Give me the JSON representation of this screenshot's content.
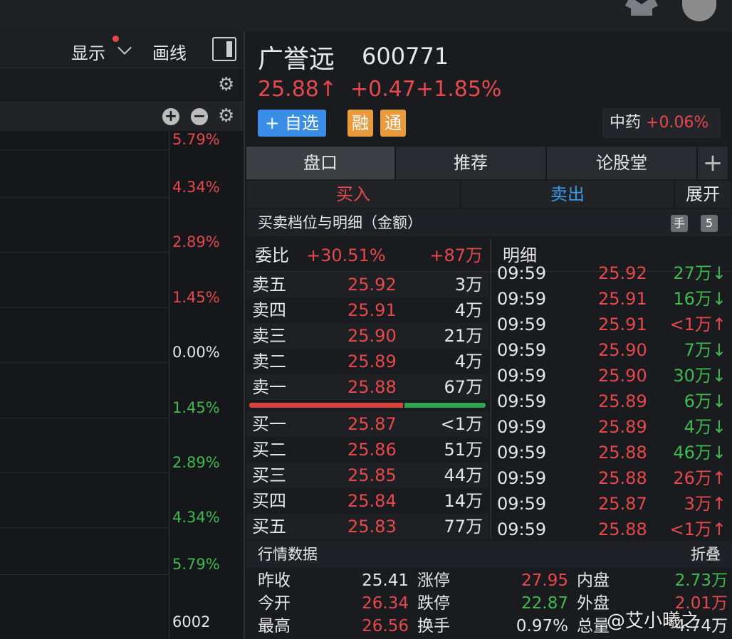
{
  "left_toolbar": {
    "display_label": "显示",
    "draw_label": "画线"
  },
  "axis_labels": [
    {
      "text": "5.79%",
      "color": "#e5484d"
    },
    {
      "text": "4.34%",
      "color": "#e5484d"
    },
    {
      "text": "2.89%",
      "color": "#e5484d"
    },
    {
      "text": "1.45%",
      "color": "#e5484d"
    },
    {
      "text": "0.00%",
      "color": "#e6e6e6"
    },
    {
      "text": "1.45%",
      "color": "#3fb950"
    },
    {
      "text": "2.89%",
      "color": "#3fb950"
    },
    {
      "text": "4.34%",
      "color": "#3fb950"
    },
    {
      "text": "5.79%",
      "color": "#3fb950"
    }
  ],
  "volume_label": "6002",
  "stock": {
    "name": "广誉远",
    "code": "600771",
    "price": "25.88↑",
    "change": "+0.47",
    "change_pct": "+1.85%",
    "fav_label": "+ 自选",
    "tag_margin": "融",
    "tag_connect": "通",
    "sector_name": "中药",
    "sector_change": "+0.06%"
  },
  "tabs": [
    "盘口",
    "推荐",
    "论股堂"
  ],
  "trade": {
    "buy": "买入",
    "sell": "卖出",
    "expand": "展开"
  },
  "book_title": "买卖档位与明细（金额）",
  "book_badge_hand": "手",
  "book_badge_level": "5",
  "order_book": {
    "ratio_label": "委比",
    "ratio_pct": "+30.51%",
    "ratio_diff": "+87万",
    "asks": [
      {
        "label": "卖五",
        "price": "25.92",
        "vol": "3万"
      },
      {
        "label": "卖四",
        "price": "25.91",
        "vol": "4万"
      },
      {
        "label": "卖三",
        "price": "25.90",
        "vol": "21万"
      },
      {
        "label": "卖二",
        "price": "25.89",
        "vol": "4万"
      },
      {
        "label": "卖一",
        "price": "25.88",
        "vol": "67万"
      }
    ],
    "bids": [
      {
        "label": "买一",
        "price": "25.87",
        "vol": "<1万"
      },
      {
        "label": "买二",
        "price": "25.86",
        "vol": "51万"
      },
      {
        "label": "买三",
        "price": "25.85",
        "vol": "44万"
      },
      {
        "label": "买四",
        "price": "25.84",
        "vol": "14万"
      },
      {
        "label": "买五",
        "price": "25.83",
        "vol": "77万"
      }
    ]
  },
  "detail": {
    "title": "明细",
    "rows": [
      {
        "time": "09:59",
        "price": "25.92",
        "vol": "27万↓",
        "dir": "down"
      },
      {
        "time": "09:59",
        "price": "25.91",
        "vol": "16万↓",
        "dir": "down"
      },
      {
        "time": "09:59",
        "price": "25.91",
        "vol": "<1万↑",
        "dir": "up"
      },
      {
        "time": "09:59",
        "price": "25.90",
        "vol": "7万↓",
        "dir": "down"
      },
      {
        "time": "09:59",
        "price": "25.90",
        "vol": "30万↓",
        "dir": "down"
      },
      {
        "time": "09:59",
        "price": "25.89",
        "vol": "6万↓",
        "dir": "down"
      },
      {
        "time": "09:59",
        "price": "25.89",
        "vol": "4万↓",
        "dir": "down"
      },
      {
        "time": "09:59",
        "price": "25.88",
        "vol": "46万↓",
        "dir": "down"
      },
      {
        "time": "09:59",
        "price": "25.88",
        "vol": "26万↑",
        "dir": "up"
      },
      {
        "time": "09:59",
        "price": "25.87",
        "vol": "3万↑",
        "dir": "up"
      },
      {
        "time": "09:59",
        "price": "25.88",
        "vol": "<1万↑",
        "dir": "up"
      }
    ]
  },
  "market": {
    "title": "行情数据",
    "collapse": "折叠",
    "rows": [
      [
        {
          "k": "昨收",
          "v": "25.41",
          "c": "white"
        },
        {
          "k": "涨停",
          "v": "27.95",
          "c": "red"
        },
        {
          "k": "内盘",
          "v": "2.73万",
          "c": "green"
        }
      ],
      [
        {
          "k": "今开",
          "v": "26.34",
          "c": "red"
        },
        {
          "k": "跌停",
          "v": "22.87",
          "c": "green"
        },
        {
          "k": "外盘",
          "v": "2.01万",
          "c": "red"
        }
      ],
      [
        {
          "k": "最高",
          "v": "26.56",
          "c": "red"
        },
        {
          "k": "换手",
          "v": "0.97%",
          "c": "white"
        },
        {
          "k": "总量",
          "v": "4.74万",
          "c": "white"
        }
      ]
    ]
  },
  "watermark": "@艾小曦之"
}
